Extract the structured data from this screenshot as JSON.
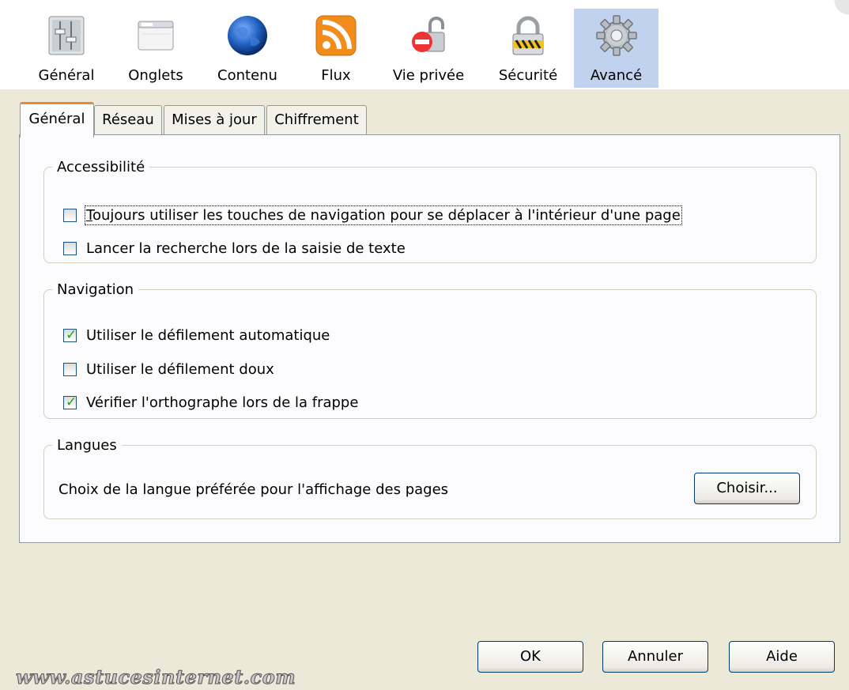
{
  "toolbar": {
    "items": [
      {
        "label": "Général",
        "icon": "general-settings-icon"
      },
      {
        "label": "Onglets",
        "icon": "tabs-window-icon"
      },
      {
        "label": "Contenu",
        "icon": "globe-content-icon"
      },
      {
        "label": "Flux",
        "icon": "rss-feed-icon"
      },
      {
        "label": "Vie privée",
        "icon": "privacy-icon"
      },
      {
        "label": "Sécurité",
        "icon": "padlock-icon"
      },
      {
        "label": "Avancé",
        "icon": "gear-icon"
      }
    ],
    "selected": "Avancé"
  },
  "tabs": [
    "Général",
    "Réseau",
    "Mises à jour",
    "Chiffrement"
  ],
  "active_tab": "Général",
  "accessibility": {
    "title": "Accessibilité",
    "options": [
      {
        "label": "Toujours utiliser les touches de navigation pour se déplacer à l'intérieur d'une page",
        "checked": false
      },
      {
        "label": "Lancer la recherche lors de la saisie de texte",
        "checked": false
      }
    ]
  },
  "navigation": {
    "title": "Navigation",
    "options": [
      {
        "label": "Utiliser le défilement automatique",
        "checked": true
      },
      {
        "label": "Utiliser le défilement doux",
        "checked": false
      },
      {
        "label": "Vérifier l'orthographe lors de la frappe",
        "checked": true
      }
    ]
  },
  "languages": {
    "title": "Langues",
    "description": "Choix de la langue préférée pour l'affichage des pages",
    "choose_button": "Choisir..."
  },
  "buttons": {
    "ok": "OK",
    "cancel": "Annuler",
    "help": "Aide"
  },
  "watermark": "www.astucesinternet.com",
  "colors": {
    "selected_toolbar": "#c1d2ee",
    "active_tab_accent": "#e68b2c",
    "check": "#21a121",
    "dialog_bg": "#ece9d8"
  }
}
